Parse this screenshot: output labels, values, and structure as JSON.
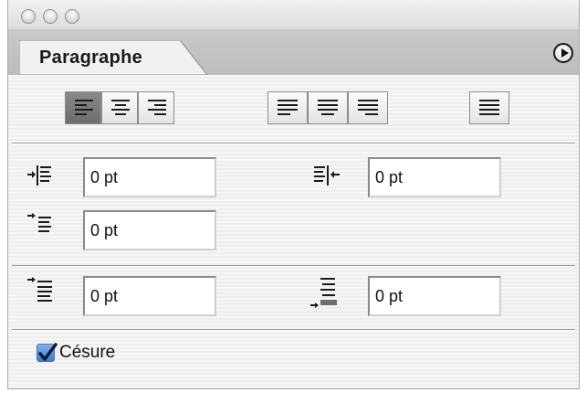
{
  "window": {
    "panel_tab_label": "Paragraphe"
  },
  "alignment": {
    "buttons": [
      {
        "name": "align-left",
        "selected": true
      },
      {
        "name": "align-center",
        "selected": false
      },
      {
        "name": "align-right",
        "selected": false
      },
      {
        "name": "justify-last-left",
        "selected": false
      },
      {
        "name": "justify-last-center",
        "selected": false
      },
      {
        "name": "justify-last-right",
        "selected": false
      },
      {
        "name": "justify-all",
        "selected": false
      }
    ]
  },
  "indents": {
    "left_indent": "0 pt",
    "right_indent": "0 pt",
    "first_line_indent": "0 pt"
  },
  "spacing": {
    "space_before": "0 pt",
    "space_after": "0 pt"
  },
  "hyphenation": {
    "label": "Césure",
    "checked": true
  },
  "colors": {
    "selected_button": "#7a7a7a",
    "checkbox_accent": "#3a7cd6"
  }
}
